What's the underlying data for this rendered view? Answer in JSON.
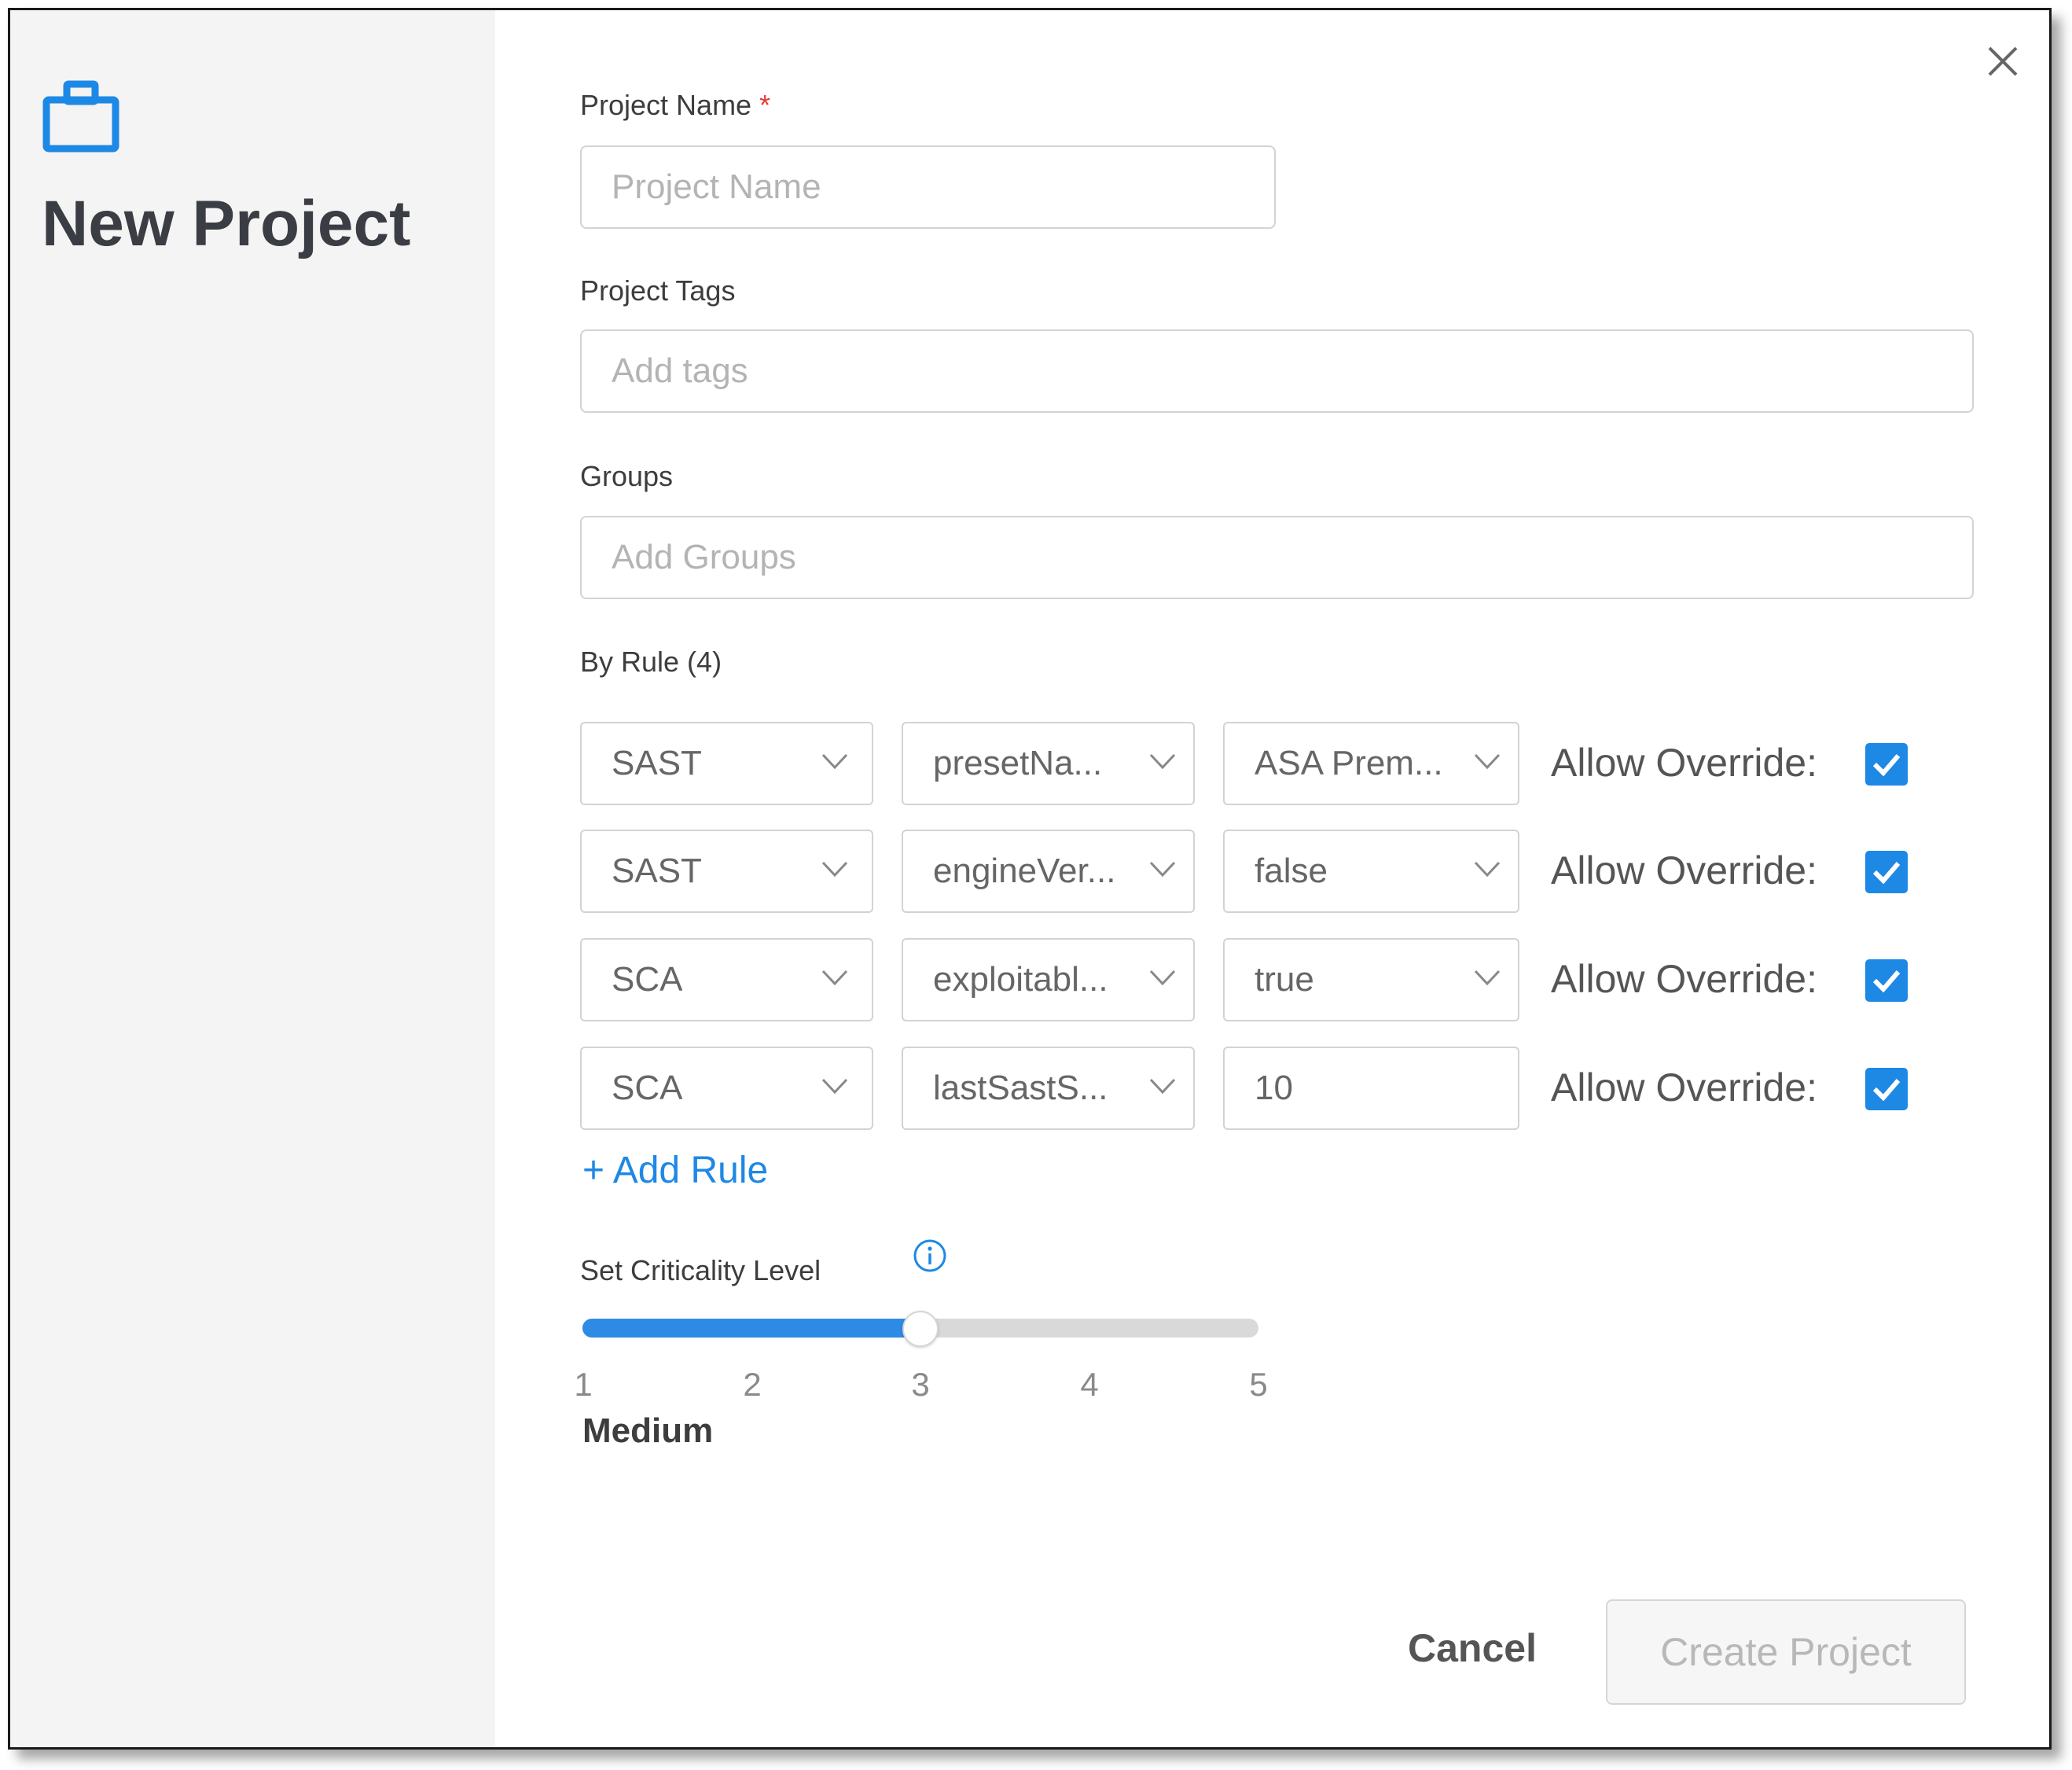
{
  "dialog": {
    "title": "New Project",
    "icon": "briefcase-icon",
    "close_icon": "close-icon"
  },
  "project_name": {
    "label": "Project Name",
    "required_marker": "*",
    "placeholder": "Project Name",
    "value": ""
  },
  "project_tags": {
    "label": "Project Tags",
    "placeholder": "Add tags",
    "value": ""
  },
  "groups": {
    "label": "Groups",
    "placeholder": "Add Groups",
    "value": ""
  },
  "rules": {
    "label": "By Rule (4)",
    "override_label": "Allow Override:",
    "items": [
      {
        "engine": "SAST",
        "key": "presetNa...",
        "value": "ASA Prem...",
        "value_type": "select",
        "allow_override": true
      },
      {
        "engine": "SAST",
        "key": "engineVer...",
        "value": "false",
        "value_type": "select",
        "allow_override": true
      },
      {
        "engine": "SCA",
        "key": "exploitabl...",
        "value": "true",
        "value_type": "select",
        "allow_override": true
      },
      {
        "engine": "SCA",
        "key": "lastSastS...",
        "value": "10",
        "value_type": "text",
        "allow_override": true
      }
    ],
    "add_label": "+ Add Rule"
  },
  "criticality": {
    "label": "Set Criticality Level",
    "info_icon": "info-icon",
    "ticks": [
      "1",
      "2",
      "3",
      "4",
      "5"
    ],
    "value": 3,
    "value_label": "Medium"
  },
  "footer": {
    "cancel_label": "Cancel",
    "create_label": "Create Project"
  },
  "colors": {
    "accent": "#1e88e5",
    "required": "#e53935",
    "sidebar_bg": "#f4f4f4",
    "disabled_text": "#b8b8b8"
  }
}
